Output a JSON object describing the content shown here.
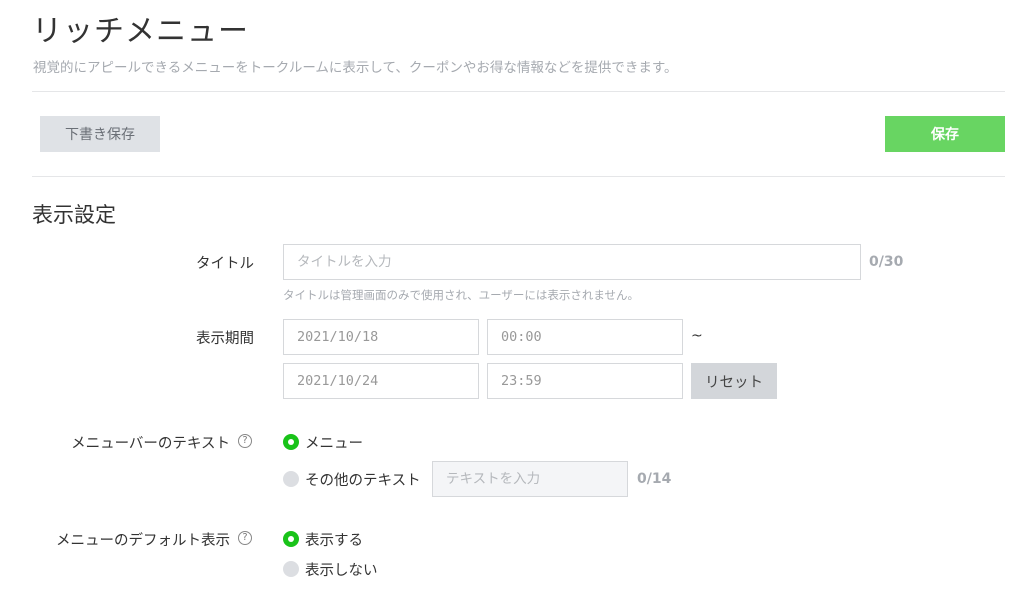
{
  "header": {
    "title": "リッチメニュー",
    "description": "視覚的にアピールできるメニューをトークルームに表示して、クーポンやお得な情報などを提供できます。"
  },
  "toolbar": {
    "draft_label": "下書き保存",
    "save_label": "保存"
  },
  "display_settings": {
    "section_title": "表示設定",
    "title_field": {
      "label": "タイトル",
      "placeholder": "タイトルを入力",
      "counter": "0/30",
      "hint": "タイトルは管理画面のみで使用され、ユーザーには表示されません。"
    },
    "period": {
      "label": "表示期間",
      "start_date": "2021/10/18",
      "start_time": "00:00",
      "separator": "~",
      "end_date": "2021/10/24",
      "end_time": "23:59",
      "reset_label": "リセット"
    },
    "menubar_text": {
      "label": "メニューバーのテキスト",
      "help_symbol": "?",
      "option_menu": "メニュー",
      "option_other": "その他のテキスト",
      "other_placeholder": "テキストを入力",
      "counter": "0/14"
    },
    "default_display": {
      "label": "メニューのデフォルト表示",
      "help_symbol": "?",
      "option_show": "表示する",
      "option_hide": "表示しない"
    }
  },
  "colors": {
    "accent_green": "#68d562",
    "radio_green": "#19c319",
    "muted_text": "#a6aab0"
  }
}
